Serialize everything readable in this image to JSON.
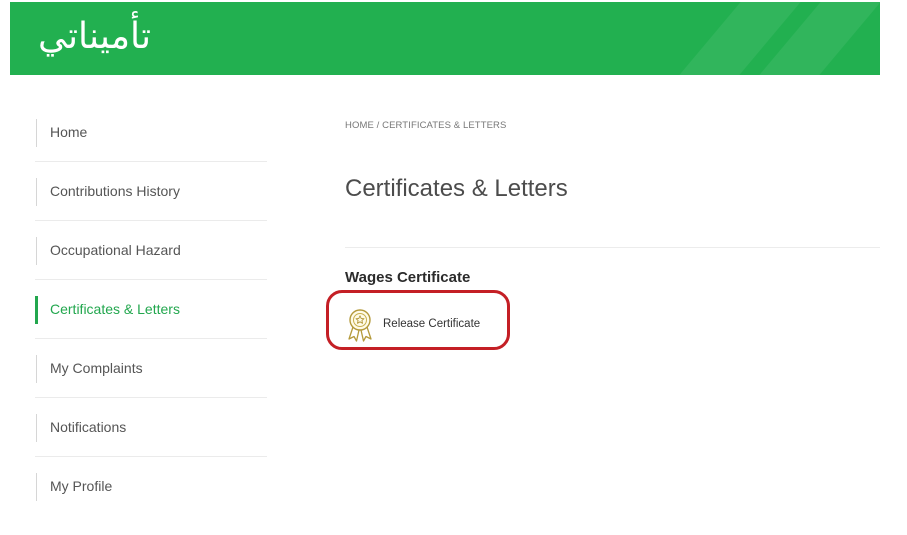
{
  "header": {
    "logo_text": "تأميناتي",
    "bg_color": "#22b050"
  },
  "sidebar": {
    "items": [
      {
        "label": "Home",
        "active": false
      },
      {
        "label": "Contributions History",
        "active": false
      },
      {
        "label": "Occupational Hazard",
        "active": false
      },
      {
        "label": "Certificates & Letters",
        "active": true
      },
      {
        "label": "My Complaints",
        "active": false
      },
      {
        "label": "Notifications",
        "active": false
      },
      {
        "label": "My Profile",
        "active": false
      }
    ],
    "active_color": "#22a74e"
  },
  "main": {
    "breadcrumb": "HOME / CERTIFICATES & LETTERS",
    "title": "Certificates & Letters",
    "section_title": "Wages Certificate",
    "links": [
      {
        "label": "Release Certificate",
        "icon": "award-ribbon-icon"
      }
    ],
    "highlight_color": "#c41f25"
  }
}
